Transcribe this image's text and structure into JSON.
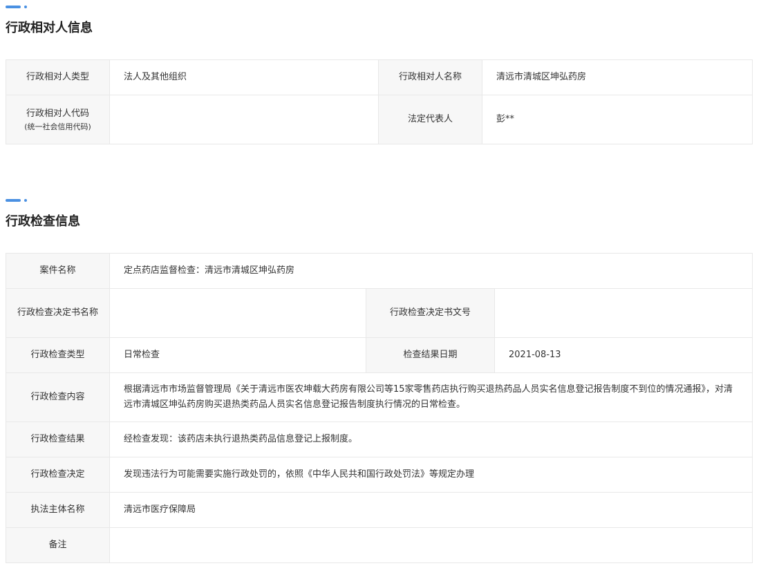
{
  "section1": {
    "title": "行政相对人信息",
    "rows": [
      {
        "label": "行政相对人类型",
        "value": "法人及其他组织",
        "label2": "行政相对人名称",
        "value2": "清远市清城区坤弘药房"
      },
      {
        "label": "行政相对人代码",
        "label_sub": "(统一社会信用代码)",
        "value": "",
        "label2": "法定代表人",
        "value2": "彭**"
      }
    ]
  },
  "section2": {
    "title": "行政检查信息",
    "case_name": {
      "label": "案件名称",
      "value": "定点药店监督检查：清远市清城区坤弘药房"
    },
    "decision_doc": {
      "label": "行政检查决定书名称",
      "value": "",
      "label2": "行政检查决定书文号",
      "value2": ""
    },
    "type": {
      "label": "行政检查类型",
      "value": "日常检查",
      "label2": "检查结果日期",
      "value2": "2021-08-13"
    },
    "content": {
      "label": "行政检查内容",
      "value": "根据清远市市场监督管理局《关于清远市医农坤载大药房有限公司等15家零售药店执行购买退热药品人员实名信息登记报告制度不到位的情况通报》，对清远市清城区坤弘药房购买退热类药品人员实名信息登记报告制度执行情况的日常检查。"
    },
    "result": {
      "label": "行政检查结果",
      "value": "经检查发现：该药店未执行退热类药品信息登记上报制度。"
    },
    "decision": {
      "label": "行政检查决定",
      "value": "发现违法行为可能需要实施行政处罚的，依照《中华人民共和国行政处罚法》等规定办理"
    },
    "authority": {
      "label": "执法主体名称",
      "value": "清远市医疗保障局"
    },
    "remark": {
      "label": "备注",
      "value": ""
    }
  }
}
